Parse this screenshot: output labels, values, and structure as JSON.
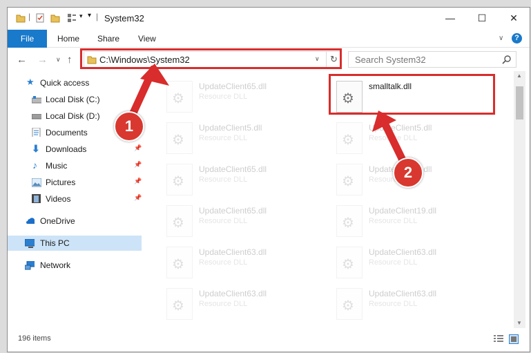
{
  "window": {
    "title": "System32",
    "minimize_glyph": "—",
    "maximize_glyph": "☐",
    "close_glyph": "✕"
  },
  "ribbon": {
    "tabs": [
      "File",
      "Home",
      "Share",
      "View"
    ],
    "help_glyph": "?"
  },
  "nav": {
    "address": "C:\\Windows\\System32",
    "search_placeholder": "Search System32"
  },
  "sidebar": {
    "items": [
      {
        "label": "Quick access",
        "icon": "star-icon",
        "pinned": false
      },
      {
        "label": "Local Disk (C:)",
        "icon": "drive-icon",
        "pinned": false
      },
      {
        "label": "Local Disk (D:)",
        "icon": "drive-icon",
        "pinned": false
      },
      {
        "label": "Documents",
        "icon": "documents-icon",
        "pinned": false
      },
      {
        "label": "Downloads",
        "icon": "download-icon",
        "pinned": true
      },
      {
        "label": "Music",
        "icon": "music-icon",
        "pinned": true
      },
      {
        "label": "Pictures",
        "icon": "pictures-icon",
        "pinned": true
      },
      {
        "label": "Videos",
        "icon": "video-icon",
        "pinned": true
      },
      {
        "label": "OneDrive",
        "icon": "cloud-icon",
        "pinned": false
      },
      {
        "label": "This PC",
        "icon": "computer-icon",
        "pinned": false,
        "selected": true
      },
      {
        "label": "Network",
        "icon": "network-icon",
        "pinned": false
      }
    ]
  },
  "files": [
    {
      "name": "UpdateClient65.dll",
      "type": "Resource DLL",
      "faded": true
    },
    {
      "name": "smalltalk.dll",
      "type": "",
      "faded": false,
      "highlighted": true
    },
    {
      "name": "UpdateClient5.dll",
      "type": "Resource DLL",
      "faded": true
    },
    {
      "name": "UpdateClient5.dll",
      "type": "Resource DLL",
      "faded": true
    },
    {
      "name": "UpdateClient65.dll",
      "type": "Resource DLL",
      "faded": true
    },
    {
      "name": "UpdateClient5.dll",
      "type": "Resource DLL",
      "faded": true
    },
    {
      "name": "UpdateClient65.dll",
      "type": "Resource DLL",
      "faded": true
    },
    {
      "name": "UpdateClient19.dll",
      "type": "Resource DLL",
      "faded": true
    },
    {
      "name": "UpdateClient63.dll",
      "type": "Resource DLL",
      "faded": true
    },
    {
      "name": "UpdateClient63.dll",
      "type": "Resource DLL",
      "faded": true
    },
    {
      "name": "UpdateClient63.dll",
      "type": "Resource DLL",
      "faded": true
    },
    {
      "name": "UpdateClient63.dll",
      "type": "Resource DLL",
      "faded": true
    }
  ],
  "status": {
    "item_count": "196 items"
  },
  "annotations": {
    "step1": "1",
    "step2": "2",
    "color": "#d92c2c"
  }
}
